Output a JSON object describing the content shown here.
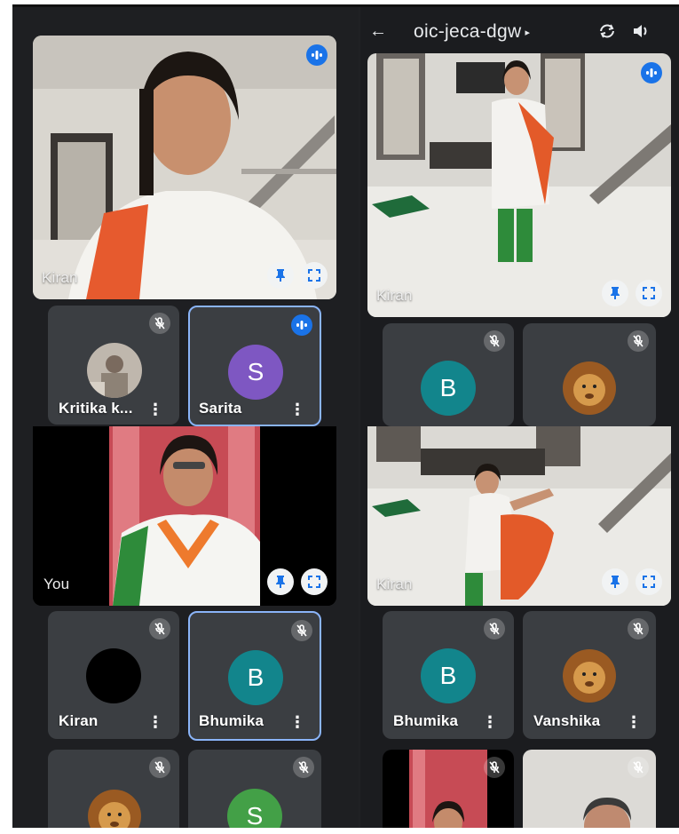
{
  "header": {
    "title": "oic-jeca-dgw",
    "back_icon": "arrow-back-icon",
    "caret": "▸"
  },
  "colors": {
    "speaking": "#1a73e8",
    "active_border": "#8ab4f8",
    "teal": "#12858c",
    "purple": "#7e57c2",
    "green": "#43a047"
  },
  "left": {
    "main": {
      "name": "Kiran"
    },
    "row1": [
      {
        "name": "Kritika k...",
        "muted": true
      },
      {
        "name": "Sarita",
        "initial": "S",
        "speaking": true
      }
    ],
    "you": {
      "name": "You"
    },
    "row2": [
      {
        "name": "Kiran",
        "muted": true
      },
      {
        "name": "Bhumika",
        "initial": "B",
        "muted": true
      }
    ],
    "row3": [
      {
        "muted": true
      },
      {
        "initial": "S",
        "muted": true
      }
    ]
  },
  "right": {
    "main1": {
      "name": "Kiran"
    },
    "row1": [
      {
        "initial": "B",
        "muted": true
      },
      {
        "muted": true
      }
    ],
    "main2": {
      "name": "Kiran"
    },
    "row2": [
      {
        "name": "Bhumika",
        "initial": "B",
        "muted": true
      },
      {
        "name": "Vanshika",
        "muted": true
      }
    ],
    "row3": [
      {
        "muted": true
      },
      {
        "muted": true
      }
    ]
  }
}
